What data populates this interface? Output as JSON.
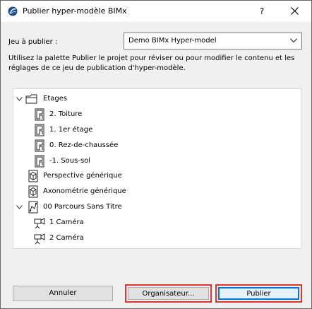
{
  "window": {
    "title": "Publier hyper-modèle BIMx",
    "help_label": "?",
    "icons": {
      "app": "archicad-logo-icon",
      "close": "close-icon"
    }
  },
  "publish_set": {
    "label": "Jeu à publier :",
    "selected": "Demo BIMx Hyper-model"
  },
  "description": "Utilisez la palette Publier le projet pour réviser ou pour modifier le contenu et les réglages de ce jeu de publication d'hyper-modèle.",
  "tree": {
    "etages": {
      "label": "Etages",
      "icon": "folder-icon",
      "expanded": true
    },
    "floors": [
      {
        "label": "2. Toiture",
        "icon": "floor-plan-icon"
      },
      {
        "label": "1. 1er étage",
        "icon": "floor-plan-icon"
      },
      {
        "label": "0. Rez-de-chaussée",
        "icon": "floor-plan-icon"
      },
      {
        "label": "-1. Sous-sol",
        "icon": "floor-plan-icon"
      }
    ],
    "perspective": {
      "label": "Perspective générique",
      "icon": "3d-view-icon"
    },
    "axonometrie": {
      "label": "Axonométrie générique",
      "icon": "3d-view-icon"
    },
    "parcours": {
      "label": "00 Parcours Sans Titre",
      "icon": "path-icon",
      "expanded": true
    },
    "cameras": [
      {
        "label": "1 Caméra",
        "icon": "camera-icon"
      },
      {
        "label": "2 Caméra",
        "icon": "camera-icon"
      }
    ]
  },
  "buttons": {
    "cancel": "Annuler",
    "organizer": "Organisateur...",
    "publish": "Publier"
  },
  "colors": {
    "highlight": "#e0362e",
    "default_button": "#0078d7"
  }
}
